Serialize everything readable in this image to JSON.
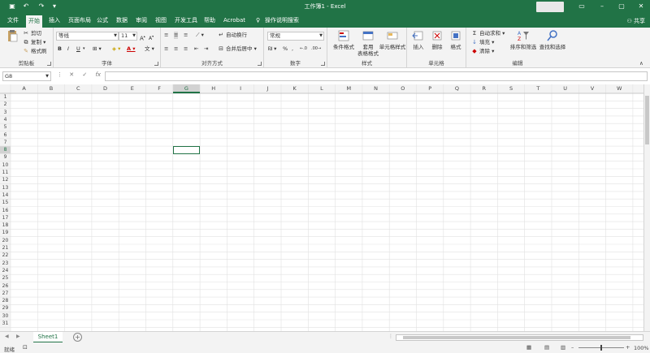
{
  "window": {
    "title": "工作簿1  -  Excel"
  },
  "ribbon_tabs": [
    "文件",
    "开始",
    "插入",
    "页面布局",
    "公式",
    "数据",
    "审阅",
    "视图",
    "开发工具",
    "帮助",
    "Acrobat"
  ],
  "active_tab": "开始",
  "tell_me": "操作说明搜索",
  "share": "共享",
  "clipboard": {
    "cut": "剪切",
    "copy": "复制",
    "format_painter": "格式刷",
    "label": "剪贴板"
  },
  "font": {
    "name": "等线",
    "size": "11",
    "label": "字体",
    "bold": "B",
    "italic": "I",
    "underline": "U"
  },
  "alignment": {
    "wrap": "自动换行",
    "merge": "合并后居中",
    "label": "对齐方式"
  },
  "number": {
    "format": "常规",
    "percent": "%",
    "label": "数字"
  },
  "styles": {
    "conditional": "条件格式",
    "table_line1": "套用",
    "table_line2": "表格格式",
    "cell_styles": "单元格样式",
    "label": "样式"
  },
  "cells": {
    "insert": "插入",
    "delete": "删除",
    "format": "格式",
    "label": "单元格"
  },
  "editing": {
    "autosum": "自动求和",
    "fill": "填充",
    "clear": "清除",
    "sort": "排序和筛选",
    "find": "查找和选择",
    "label": "编辑"
  },
  "formula_bar": {
    "name_box": "G8",
    "fx": "fx"
  },
  "columns": [
    "A",
    "B",
    "C",
    "D",
    "E",
    "F",
    "G",
    "H",
    "I",
    "J",
    "K",
    "L",
    "M",
    "N",
    "O",
    "P",
    "Q",
    "R",
    "S",
    "T",
    "U",
    "V",
    "W"
  ],
  "rows": [
    "1",
    "2",
    "3",
    "4",
    "5",
    "6",
    "7",
    "8",
    "9",
    "10",
    "11",
    "12",
    "13",
    "14",
    "15",
    "16",
    "17",
    "18",
    "19",
    "20",
    "21",
    "22",
    "23",
    "24",
    "25",
    "26",
    "27",
    "28",
    "29",
    "30",
    "31"
  ],
  "active_cell": {
    "col": "G",
    "row": "8"
  },
  "sheet_tabs": [
    "Sheet1"
  ],
  "status": {
    "ready": "就绪",
    "zoom": "100%"
  },
  "colors": {
    "brand": "#217346",
    "gridline": "#e1e1e1",
    "header_bg": "#f3f3f3"
  }
}
